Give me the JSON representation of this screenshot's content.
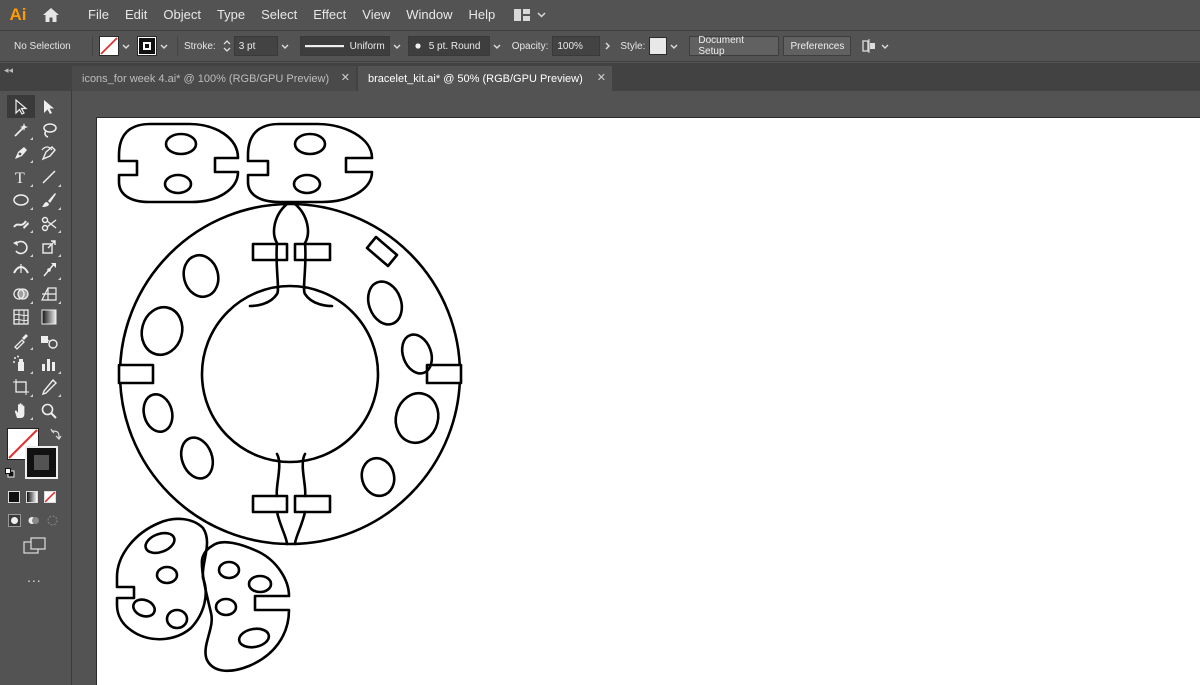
{
  "app": {
    "logo": "Ai"
  },
  "menu": [
    "File",
    "Edit",
    "Object",
    "Type",
    "Select",
    "Effect",
    "View",
    "Window",
    "Help"
  ],
  "control_bar": {
    "selection_label": "No Selection",
    "stroke_label": "Stroke:",
    "stroke_weight": "3 pt",
    "profile_label": "Uniform",
    "brush_label": "5 pt. Round",
    "opacity_label": "Opacity:",
    "opacity_value": "100%",
    "style_label": "Style:",
    "document_setup_label": "Document Setup",
    "preferences_label": "Preferences"
  },
  "tabs": [
    {
      "title": "icons_for week 4.ai* @ 100% (RGB/GPU Preview)",
      "active": false
    },
    {
      "title": "bracelet_kit.ai* @ 50% (RGB/GPU Preview)",
      "active": true
    }
  ],
  "toolbar": {
    "tools": [
      "selection-tool",
      "direct-selection-tool",
      "magic-wand-tool",
      "lasso-tool",
      "pen-tool",
      "curvature-tool",
      "type-tool",
      "line-segment-tool",
      "ellipse-tool",
      "paintbrush-tool",
      "shaper-tool",
      "scissors-tool",
      "rotate-tool",
      "scale-tool",
      "width-tool",
      "puppet-warp-tool",
      "shape-builder-tool",
      "perspective-grid-tool",
      "mesh-tool",
      "gradient-tool",
      "eyedropper-tool",
      "blend-tool",
      "symbol-sprayer-tool",
      "column-graph-tool",
      "artboard-tool",
      "slice-tool",
      "hand-tool",
      "zoom-tool"
    ],
    "more_label": "..."
  },
  "colors": {
    "accent": "#ff9a00",
    "ui_background": "#535353",
    "tab_bar": "#424242",
    "artboard": "#ffffff",
    "stroke": "#000000",
    "none_slash": "#e03030"
  }
}
